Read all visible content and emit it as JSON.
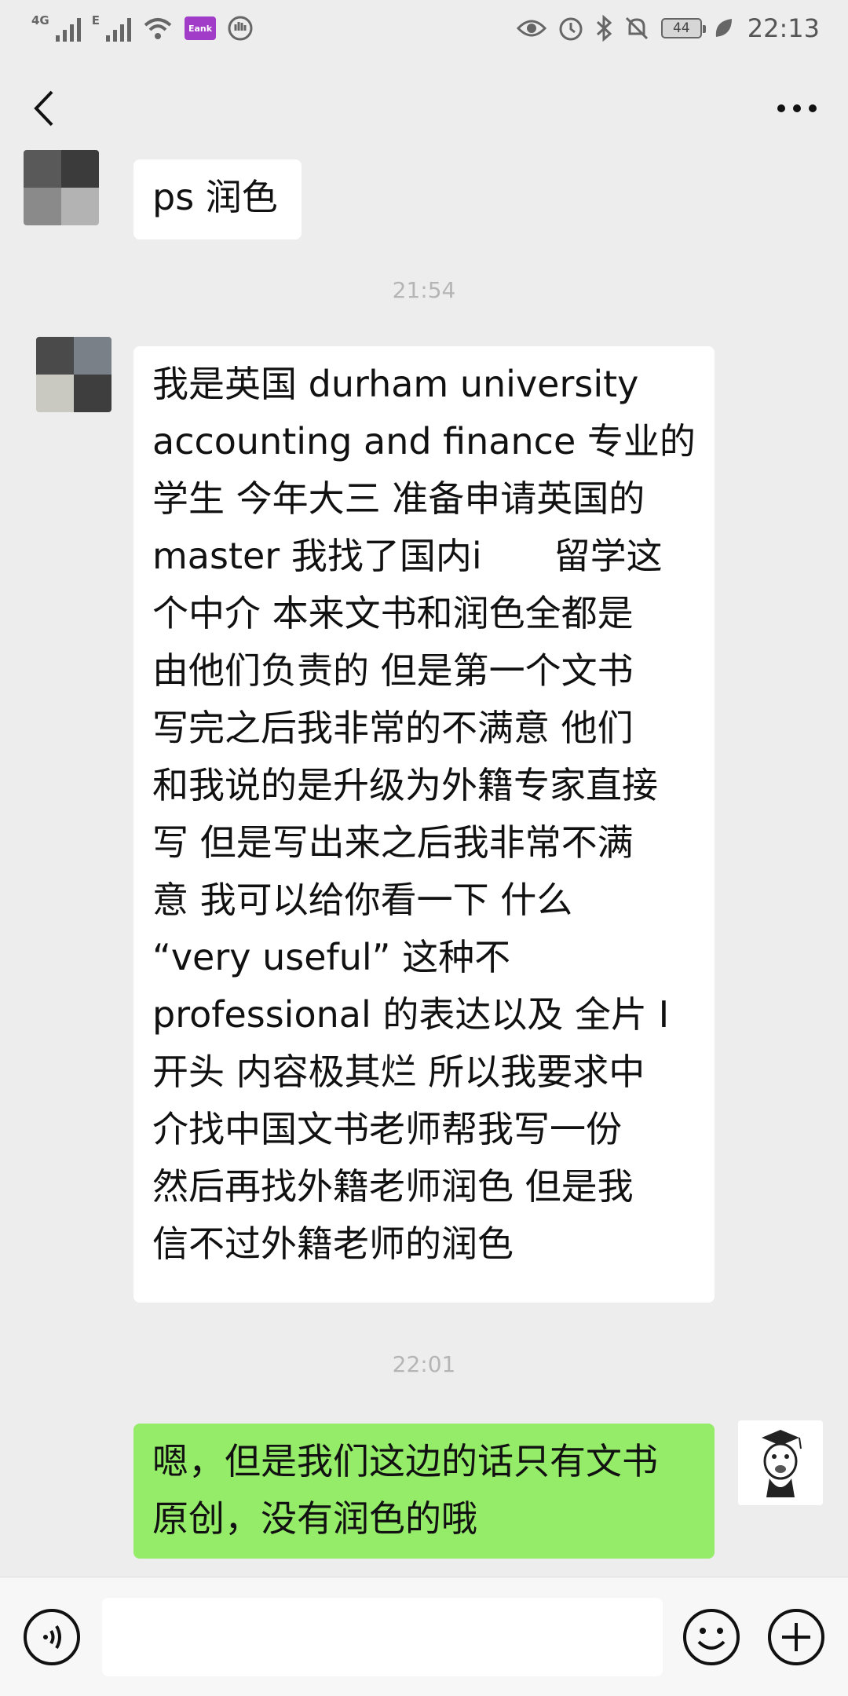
{
  "status_bar": {
    "network_1": "4G",
    "network_2": "E",
    "app_badge": "Eank",
    "battery": "44",
    "time": "22:13"
  },
  "messages": [
    {
      "direction": "in",
      "text": "ps 润色"
    },
    {
      "type": "timestamp",
      "text": "21:54"
    },
    {
      "direction": "in",
      "text": "我是英国 durham university\naccounting and finance 专业的\n学生 今年大三 准备申请英国的\nmaster 我找了国内i　　留学这\n个中介 本来文书和润色全都是\n由他们负责的 但是第一个文书\n写完之后我非常的不满意 他们\n和我说的是升级为外籍专家直接\n写 但是写出来之后我非常不满\n意 我可以给你看一下 什么\n“very useful” 这种不\nprofessional 的表达以及 全片 I\n开头 内容极其烂 所以我要求中\n介找中国文书老师帮我写一份\n然后再找外籍老师润色 但是我\n信不过外籍老师的润色"
    },
    {
      "type": "timestamp",
      "text": "22:01"
    },
    {
      "direction": "out",
      "text": "嗯，但是我们这边的话只有文书\n原创，没有润色的哦"
    }
  ],
  "input_bar": {
    "placeholder": ""
  },
  "colors": {
    "background": "#ededed",
    "incoming_bubble": "#ffffff",
    "outgoing_bubble": "#95ec69",
    "timestamp_text": "#b5b5b5"
  },
  "icons": [
    "back-arrow-icon",
    "more-dots-icon",
    "voice-icon",
    "emoji-icon",
    "plus-icon",
    "eye-icon",
    "alarm-icon",
    "bluetooth-icon",
    "mute-bell-icon",
    "leaf-icon",
    "wifi-icon",
    "signal-icon"
  ]
}
